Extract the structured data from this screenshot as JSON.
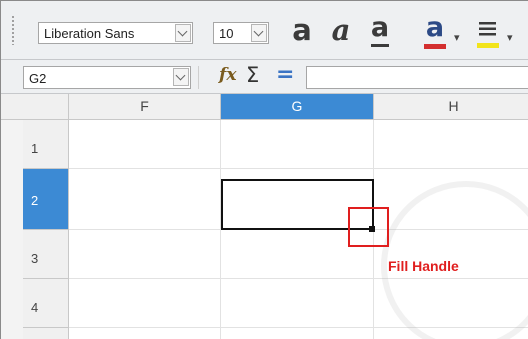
{
  "toolbar": {
    "font_name": "Liberation Sans",
    "font_size": "10",
    "bold_label": "a",
    "italic_label": "a",
    "underline_label": "a",
    "font_color_label": "a",
    "font_color": "#d32f2f",
    "highlight_color": "#f2e41b",
    "dropdown_arrow": "▾"
  },
  "formula_bar": {
    "name_box": "G2",
    "function_wizard_icon": "fx",
    "sum_icon": "Σ",
    "equals_icon": "="
  },
  "columns": [
    "F",
    "G",
    "H"
  ],
  "selected_column": "G",
  "rows": [
    "1",
    "2",
    "3",
    "4"
  ],
  "selected_row": "2",
  "annotation": {
    "label": "Fill Handle",
    "color": "#e01e1e"
  }
}
